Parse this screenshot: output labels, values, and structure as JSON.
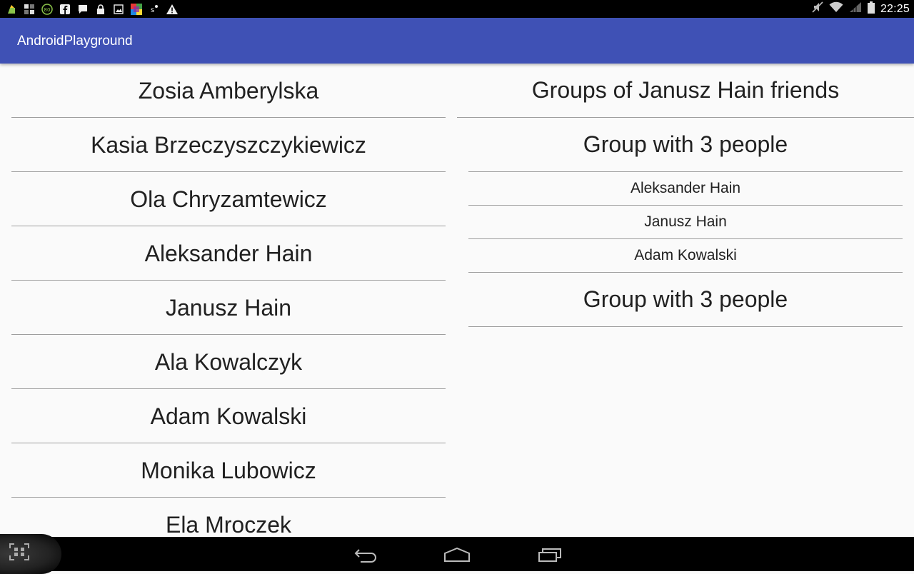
{
  "status_bar": {
    "time": "22:25",
    "left_icons": [
      "cleaner-icon",
      "image-grid-icon",
      "speed-80-icon",
      "facebook-icon",
      "chat-icon",
      "lock-icon",
      "photo-icon",
      "colorful-app-icon",
      "notification-s-icon",
      "warning-icon"
    ],
    "right_icons": [
      "mute-icon",
      "wifi-icon",
      "signal-icon",
      "battery-icon"
    ]
  },
  "app_bar": {
    "title": "AndroidPlayground"
  },
  "people": [
    "Zosia Amberylska",
    "Kasia Brzeczyszczykiewicz",
    "Ola Chryzamtewicz",
    "Aleksander Hain",
    "Janusz Hain",
    "Ala Kowalczyk",
    "Adam Kowalski",
    "Monika Lubowicz",
    "Ela Mroczek"
  ],
  "groups_panel": {
    "header": "Groups of Janusz Hain friends",
    "groups": [
      {
        "title": "Group with 3 people",
        "members": [
          "Aleksander Hain",
          "Janusz Hain",
          "Adam Kowalski"
        ]
      },
      {
        "title": "Group with 3 people",
        "members": []
      }
    ]
  },
  "nav_bar": {
    "buttons": [
      "back-icon",
      "home-icon",
      "recents-icon"
    ],
    "overlay": "screen-capture-icon"
  }
}
